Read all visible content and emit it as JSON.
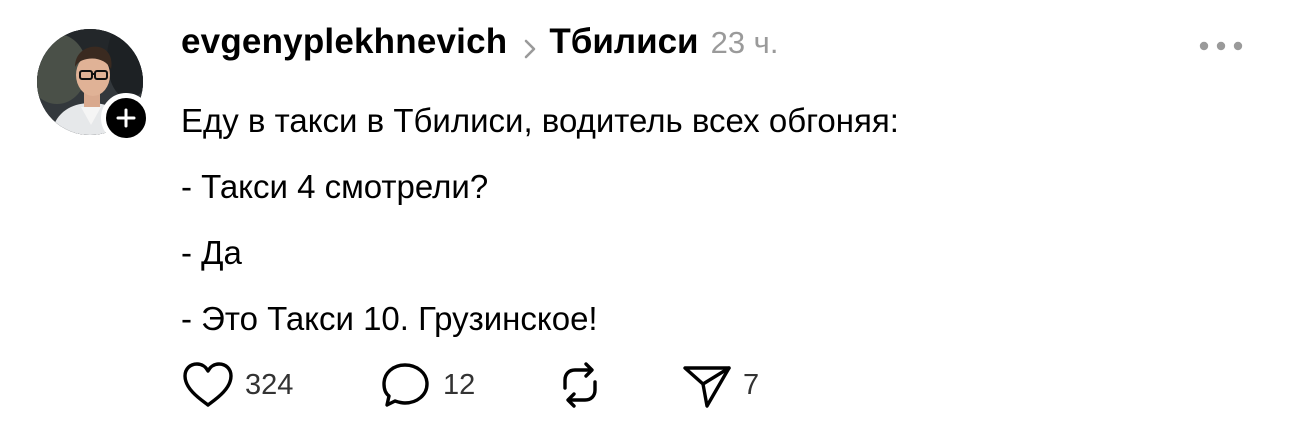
{
  "post": {
    "author": {
      "username": "evgenyplekhnevich",
      "avatar_icon": "avatar",
      "follow_icon": "plus-icon"
    },
    "topic": "Тбилиси",
    "time": "23 ч.",
    "more_icon": "more-icon",
    "text_lines": [
      "Еду в такси в Тбилиси, водитель всех обгоняя:",
      "- Такси 4 смотрели?",
      "- Да",
      "- Это Такси 10. Грузинское!"
    ],
    "actions": {
      "like": {
        "icon": "heart-icon",
        "count": "324"
      },
      "comment": {
        "icon": "comment-icon",
        "count": "12"
      },
      "repost": {
        "icon": "repost-icon",
        "count": ""
      },
      "share": {
        "icon": "send-icon",
        "count": "7"
      }
    }
  }
}
